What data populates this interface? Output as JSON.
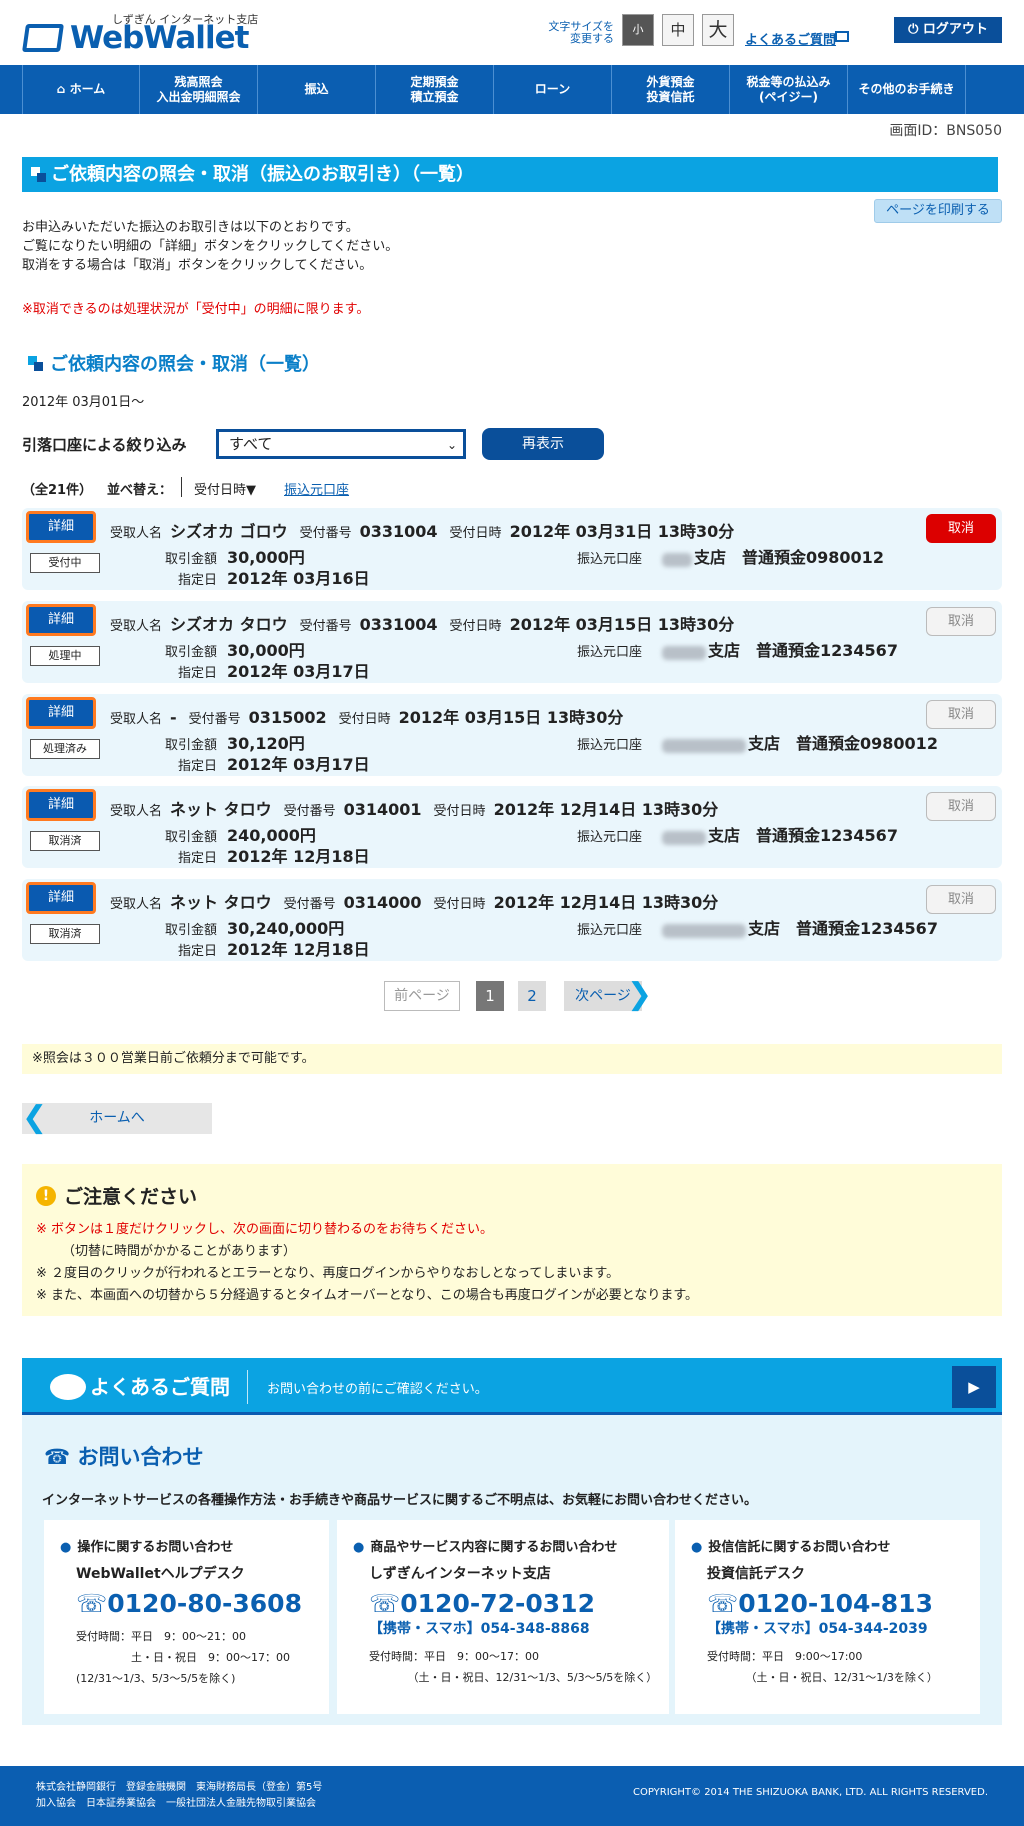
{
  "header": {
    "logo_sub": "しずぎん インターネット支店",
    "logo_text": "WebWallet",
    "font_size_label": "文字サイズを変更する",
    "fs_small": "小",
    "fs_mid": "中",
    "fs_big": "大",
    "faq_link": "よくあるご質問",
    "logout": "ログアウト"
  },
  "nav": [
    "ホーム",
    "残高照会\n入出金明細照会",
    "振込",
    "定期預金\n積立預金",
    "ローン",
    "外貨預金\n投資信託",
    "税金等の払込み\n(ペイジー)",
    "その他のお手続き"
  ],
  "screen_id": "画面ID：BNS050",
  "page_title": "ご依頼内容の照会・取消（振込のお取引き）（一覧）",
  "print_button": "ページを印刷する",
  "intro": [
    "お申込みいただいた振込のお取引きは以下のとおりです。",
    "ご覧になりたい明細の「詳細」ボタンをクリックしてください。",
    "取消をする場合は「取消」ボタンをクリックしてください。"
  ],
  "cancel_note": "※取消できるのは処理状況が「受付中」の明細に限ります。",
  "section_title": "ご依頼内容の照会・取消（一覧）",
  "date_from": "2012年 03月01日〜",
  "filter": {
    "label": "引落口座による絞り込み",
    "selected": "すべて",
    "button": "再表示"
  },
  "list": {
    "count": "（全21件）",
    "sort_label": "並べ替え：",
    "sort_by": "受付日時▼",
    "sort_link": "振込元口座"
  },
  "labels": {
    "payee": "受取人名",
    "receipt_no": "受付番号",
    "receipt_dt": "受付日時",
    "amount": "取引金額",
    "date": "指定日",
    "account": "振込元口座",
    "detail": "詳細",
    "cancel": "取消"
  },
  "rows": [
    {
      "status": "受付中",
      "payee": "シズオカ ゴロウ",
      "no": "0331004",
      "dt": "2012年 03月31日 13時30分",
      "amount": "30,000円",
      "date": "2012年 03月16日",
      "account": "支店　普通預金0980012",
      "cancel_enabled": true
    },
    {
      "status": "処理中",
      "payee": "シズオカ タロウ",
      "no": "0331004",
      "dt": "2012年 03月15日 13時30分",
      "amount": "30,000円",
      "date": "2012年 03月17日",
      "account": "支店　普通預金1234567",
      "cancel_enabled": false
    },
    {
      "status": "処理済み",
      "payee": "-",
      "no": "0315002",
      "dt": "2012年 03月15日 13時30分",
      "amount": "30,120円",
      "date": "2012年 03月17日",
      "account": "支店　普通預金0980012",
      "cancel_enabled": false
    },
    {
      "status": "取消済",
      "payee": "ネット タロウ",
      "no": "0314001",
      "dt": "2012年 12月14日 13時30分",
      "amount": "240,000円",
      "date": "2012年 12月18日",
      "account": "支店　普通預金1234567",
      "cancel_enabled": false
    },
    {
      "status": "取消済",
      "payee": "ネット タロウ",
      "no": "0314000",
      "dt": "2012年 12月14日 13時30分",
      "amount": "30,240,000円",
      "date": "2012年 12月18日",
      "account": "支店　普通預金1234567",
      "cancel_enabled": false
    }
  ],
  "pager": {
    "prev": "前ページ",
    "p1": "1",
    "p2": "2",
    "next": "次ページ"
  },
  "inquiry_note": "※照会は３００営業日前ご依頼分まで可能です。",
  "home_button": "ホームへ",
  "caution": {
    "title": "ご注意ください",
    "l1": "※ ボタンは１度だけクリックし、次の画面に切り替わるのをお待ちください。",
    "l2": "（切替に時間がかかることがあります）",
    "l3": "※ ２度目のクリックが行われるとエラーとなり、再度ログインからやりなおしとなってしまいます。",
    "l4": "※ また、本画面への切替から５分経過するとタイムオーバーとなり、この場合も再度ログインが必要となります。"
  },
  "faq": {
    "title": "よくあるご質問",
    "sub": "お問い合わせの前にご確認ください。"
  },
  "contact": {
    "title": "お問い合わせ",
    "lead": "インターネットサービスの各種操作方法・お手続きや商品サービスに関するご不明点は、お気軽にお問い合わせください。",
    "boxes": [
      {
        "t": "操作に関するお問い合わせ",
        "n": "WebWalletヘルプデスク",
        "tel": "0120-80-3608",
        "m": "",
        "h": "受付時間：平日　9：00〜21：00\n　　　　　土・日・祝日　9：00〜17：00\n(12/31〜1/3、5/3〜5/5を除く)"
      },
      {
        "t": "商品やサービス内容に関するお問い合わせ",
        "n": "しずぎんインターネット支店",
        "tel": "0120-72-0312",
        "m": "【携帯・スマホ】054-348-8868",
        "h": "受付時間：平日　9：00〜17：00\n　　　　（土・日・祝日、12/31〜1/3、5/3〜5/5を除く）"
      },
      {
        "t": "投信信託に関するお問い合わせ",
        "n": "投資信託デスク",
        "tel": "0120-104-813",
        "m": "【携帯・スマホ】054-344-2039",
        "h": "受付時間：平日　9:00〜17:00\n　　　　（土・日・祝日、12/31〜1/3を除く）"
      }
    ]
  },
  "footer": {
    "l1": "株式会社静岡銀行　登録金融機関　東海財務局長（登金）第5号",
    "l2": "加入協会　日本証券業協会　一般社団法人金融先物取引業協会",
    "copyright": "COPYRIGHT© 2014 THE SHIZUOKA BANK, LTD. ALL RIGHTS RESERVED."
  }
}
